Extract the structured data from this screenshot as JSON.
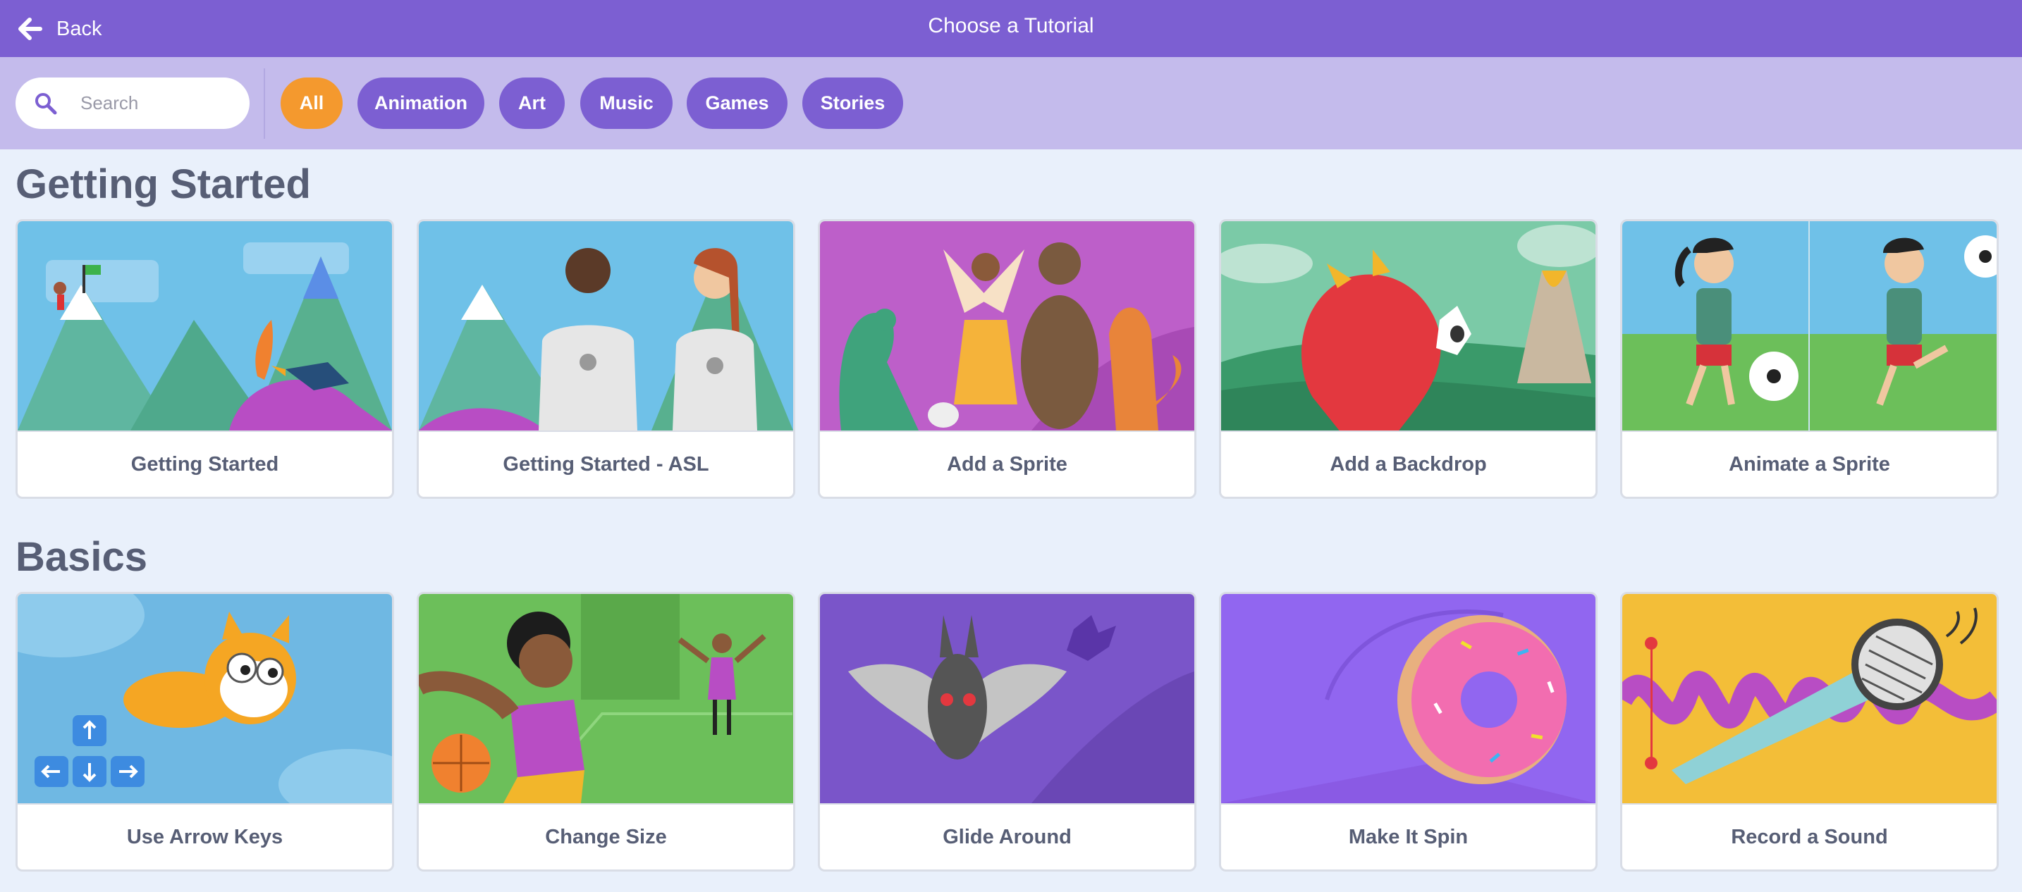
{
  "header": {
    "back_label": "Back",
    "title": "Choose a Tutorial",
    "back_icon": "arrow-left-icon"
  },
  "filters": {
    "search_placeholder": "Search",
    "search_icon": "search-icon",
    "pills": [
      "All",
      "Animation",
      "Art",
      "Music",
      "Games",
      "Stories"
    ],
    "active_pill": "All"
  },
  "colors": {
    "header_bg": "#7c5fd2",
    "filter_bar_bg": "#c4bbec",
    "active_pill": "#f4992e",
    "pill": "#7c5fd2",
    "page_bg": "#e9f0fb",
    "text": "#575e75"
  },
  "sections": [
    {
      "title": "Getting Started",
      "cards": [
        {
          "label": "Getting Started"
        },
        {
          "label": "Getting Started - ASL"
        },
        {
          "label": "Add a Sprite"
        },
        {
          "label": "Add a Backdrop"
        },
        {
          "label": "Animate a Sprite"
        }
      ]
    },
    {
      "title": "Basics",
      "cards": [
        {
          "label": "Use Arrow Keys"
        },
        {
          "label": "Change Size"
        },
        {
          "label": "Glide Around"
        },
        {
          "label": "Make It Spin"
        },
        {
          "label": "Record a Sound"
        }
      ]
    }
  ]
}
